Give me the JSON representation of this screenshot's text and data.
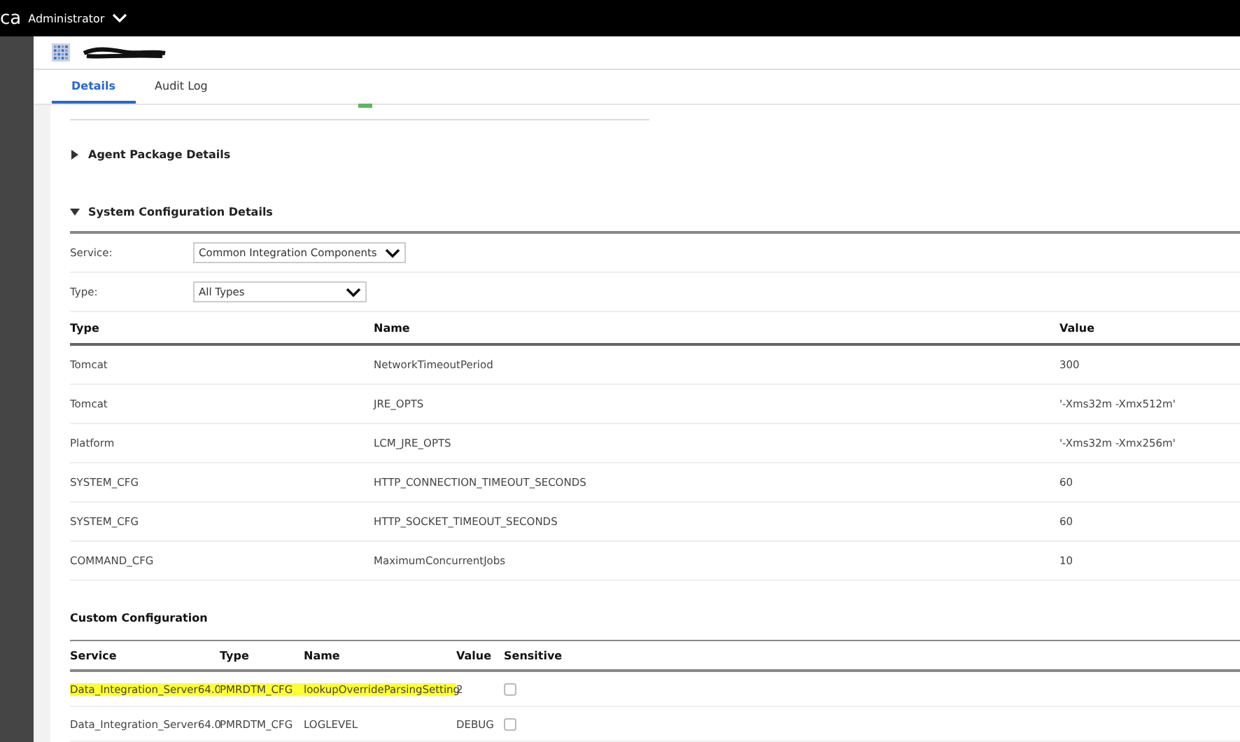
{
  "top_bar": {
    "brand": "ca",
    "user": "Administrator"
  },
  "tabs": [
    {
      "label": "Details",
      "selected": true
    },
    {
      "label": "Audit Log",
      "selected": false
    }
  ],
  "sections": [
    {
      "title": "Agent Package Details",
      "expanded": false
    },
    {
      "title": "System Configuration Details",
      "expanded": true
    }
  ],
  "filters": [
    {
      "label": "Service:",
      "value": "Common Integration Components"
    },
    {
      "label": "Type:",
      "value": "All Types"
    }
  ],
  "system_table": {
    "columns": [
      "Type",
      "Name",
      "Value"
    ],
    "rows": [
      [
        "Tomcat",
        "NetworkTimeoutPeriod",
        "300"
      ],
      [
        "Tomcat",
        "JRE_OPTS",
        "'-Xms32m -Xmx512m'"
      ],
      [
        "Platform",
        "LCM_JRE_OPTS",
        "'-Xms32m -Xmx256m'"
      ],
      [
        "SYSTEM_CFG",
        "HTTP_CONNECTION_TIMEOUT_SECONDS",
        "60"
      ],
      [
        "SYSTEM_CFG",
        "HTTP_SOCKET_TIMEOUT_SECONDS",
        "60"
      ],
      [
        "COMMAND_CFG",
        "MaximumConcurrentJobs",
        "10"
      ]
    ]
  },
  "custom_config": {
    "title": "Custom Configuration",
    "columns": [
      "Service",
      "Type",
      "Name",
      "Value",
      "Sensitive"
    ],
    "rows": [
      {
        "service": "Data_Integration_Server64.0",
        "type": "PMRDTM_CFG",
        "name": "lookupOverrideParsingSetting",
        "value": "2",
        "sensitive": false,
        "highlighted": true
      },
      {
        "service": "Data_Integration_Server64.0",
        "type": "PMRDTM_CFG",
        "name": "LOGLEVEL",
        "value": "DEBUG",
        "sensitive": false,
        "highlighted": false
      }
    ]
  }
}
